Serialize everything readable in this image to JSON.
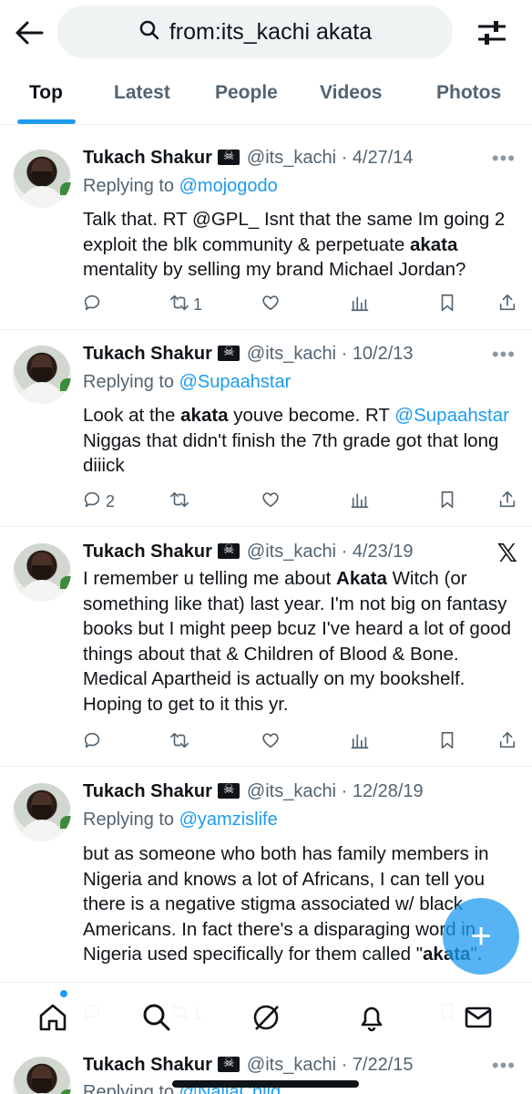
{
  "search": {
    "query": "from:its_kachi akata"
  },
  "tabs": [
    {
      "label": "Top"
    },
    {
      "label": "Latest"
    },
    {
      "label": "People"
    },
    {
      "label": "Videos"
    },
    {
      "label": "Photos"
    }
  ],
  "tweets": [
    {
      "name": "Tukach Shakur",
      "handle": "@its_kachi",
      "date": "4/27/14",
      "replying_prefix": "Replying to",
      "replying_to": "@mojogodo",
      "text_a": "Talk that. RT @GPL_ Isnt that the same Im going 2 exploit the blk community & perpetuate ",
      "text_bold": "akata",
      "text_b": " mentality by selling my brand Michael Jordan?",
      "replies": "",
      "retweets": "1"
    },
    {
      "name": "Tukach Shakur",
      "handle": "@its_kachi",
      "date": "10/2/13",
      "replying_prefix": "Replying to",
      "replying_to": "@Supaahstar",
      "text_a": "Look at the ",
      "text_bold": "akata",
      "text_b": " youve become. RT ",
      "text_link": "@Supaahstar",
      "text_c": " Niggas that didn't finish the 7th grade got that long diiick",
      "replies": "2",
      "retweets": ""
    },
    {
      "name": "Tukach Shakur",
      "handle": "@its_kachi",
      "date": "4/23/19",
      "text_a": "I remember u telling me about ",
      "text_bold": "Akata",
      "text_b": " Witch (or something like that) last year. I'm not big on fantasy books but I might peep bcuz I've heard a lot of good things about that & Children of Blood & Bone. Medical Apartheid is actually on my bookshelf. Hoping to get to it this yr.",
      "replies": "",
      "retweets": ""
    },
    {
      "name": "Tukach Shakur",
      "handle": "@its_kachi",
      "date": "12/28/19",
      "replying_prefix": "Replying to",
      "replying_to": "@yamzislife",
      "text_a": "but as someone who both has family members in Nigeria and knows a lot of Africans, I can tell you there is a negative stigma associated w/ black Americans. In fact there's a disparaging word in Nigeria used specifically for them called \"",
      "text_bold": "akata",
      "text_b": "\".",
      "replies": "",
      "retweets": "1"
    },
    {
      "name": "Tukach Shakur",
      "handle": "@its_kachi",
      "date": "7/22/15",
      "replying_prefix": "Replying to",
      "replying_to": "@NaijaChild"
    }
  ],
  "colors": {
    "accent": "#1d9bf0",
    "text": "#0f1419",
    "muted": "#536471"
  },
  "icons": [
    "back-arrow-icon",
    "search-icon",
    "filter-sliders-icon",
    "reply-icon",
    "retweet-icon",
    "like-icon",
    "views-icon",
    "bookmark-icon",
    "share-icon",
    "x-logo-icon",
    "home-icon",
    "explore-icon",
    "grok-icon",
    "notifications-icon",
    "messages-icon",
    "compose-plus-icon"
  ]
}
